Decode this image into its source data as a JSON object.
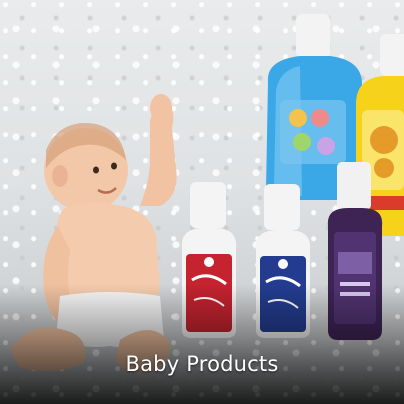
{
  "tile": {
    "caption": "Baby Products",
    "image": {
      "subject": "baby-with-toiletries",
      "icon": "product-photo"
    },
    "colors": {
      "caption_text": "#ffffff",
      "overlay": "#000000"
    }
  }
}
